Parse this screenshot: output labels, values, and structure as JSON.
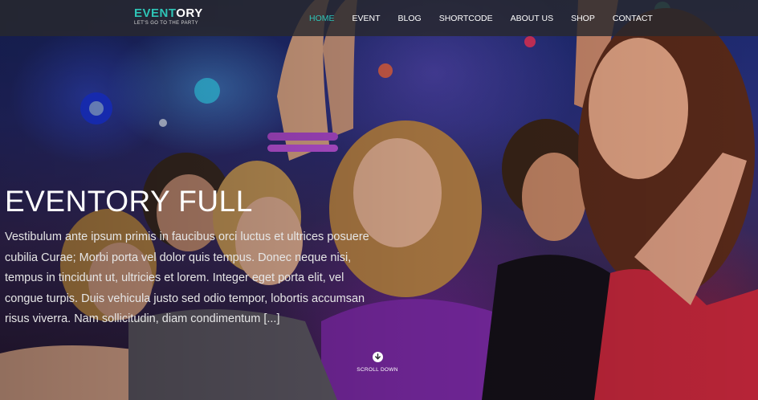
{
  "brand": {
    "name_accent": "EVENT",
    "name_rest": "ORY",
    "tagline": "LET'S GO TO THE PARTY",
    "accent_color": "#2ec4b6"
  },
  "nav": {
    "items": [
      {
        "label": "HOME",
        "active": true
      },
      {
        "label": "EVENT",
        "active": false
      },
      {
        "label": "BLOG",
        "active": false
      },
      {
        "label": "SHORTCODE",
        "active": false
      },
      {
        "label": "ABOUT US",
        "active": false
      },
      {
        "label": "SHOP",
        "active": false
      },
      {
        "label": "CONTACT",
        "active": false
      }
    ]
  },
  "hero": {
    "title": "EVENTORY FULL",
    "excerpt": "Vestibulum ante ipsum primis in faucibus orci luctus et ultrices posuere cubilia Curae; Morbi porta vel dolor quis tempus. Donec neque nisi, tempus in tincidunt ut, ultricies et lorem. Integer eget porta elit, vel congue turpis. Duis vehicula justo sed odio tempor, lobortis accumsan risus viverra. Nam sollicitudin, diam condimentum [...]",
    "scroll_label": "SCROLL DOWN",
    "scroll_icon": "arrow-down-circle-icon"
  }
}
